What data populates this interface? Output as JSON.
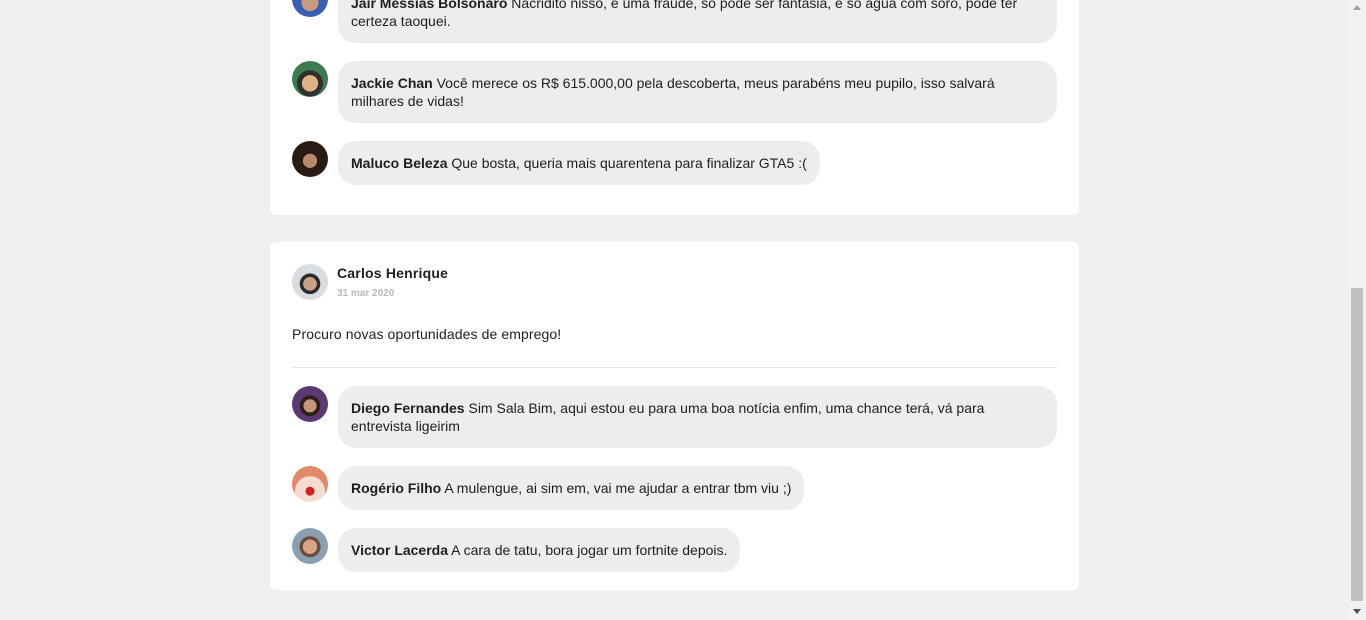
{
  "posts": [
    {
      "comments": [
        {
          "name": "Jair Messias Bolsonaro",
          "text": "Nacridito nisso, é uma fraude, só pode ser fantasia, é só agua com soro, pode ter certeza taoquei."
        },
        {
          "name": "Jackie Chan",
          "text": "Você merece os R$ 615.000,00 pela descoberta, meus parabéns meu pupilo, isso salvará milhares de vidas!"
        },
        {
          "name": "Maluco Beleza",
          "text": "Que bosta, queria mais quarentena para finalizar GTA5 :("
        }
      ]
    },
    {
      "author": "Carlos Henrique",
      "date": "31 mar 2020",
      "text": "Procuro novas oportunidades de emprego!",
      "comments": [
        {
          "name": "Diego Fernandes",
          "text": "Sim Sala Bim, aqui estou eu para uma boa notícia enfim, uma chance terá, vá para entrevista ligeirim"
        },
        {
          "name": "Rogério Filho",
          "text": "A mulengue, ai sim em, vai me ajudar a entrar tbm viu ;)"
        },
        {
          "name": "Victor Lacerda",
          "text": "A cara de tatu, bora jogar um fortnite depois."
        }
      ]
    }
  ]
}
